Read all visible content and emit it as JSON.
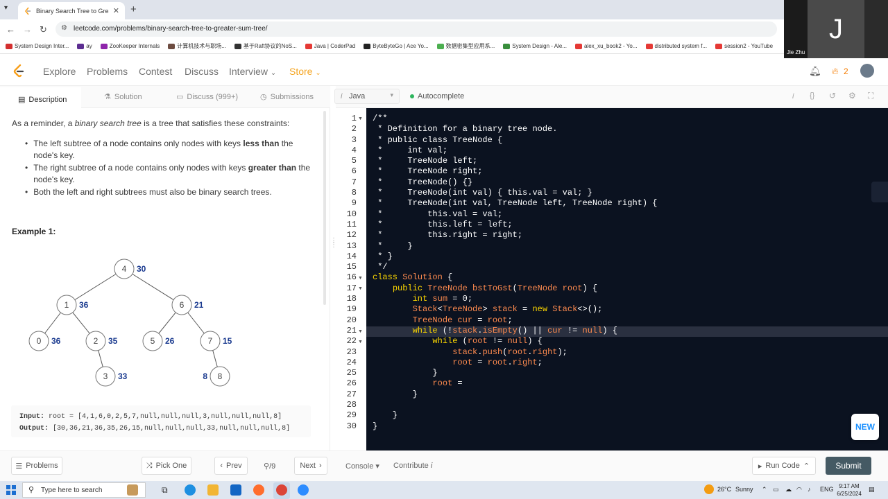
{
  "browser": {
    "tab_title": "Binary Search Tree to Greater Sum Tree",
    "url": "leetcode.com/problems/binary-search-tree-to-greater-sum-tree/",
    "bookmarks": [
      "System Design Inter...",
      "ay",
      "ZooKeeper Internals",
      "计算机技术与职场...",
      "基于Raft协议的NoS...",
      "Java | CoderPad",
      "ByteByteGo | Ace Yo...",
      "数据密集型应用系...",
      "System Design - Ale...",
      "alex_xu_book2 - Yo...",
      "distributed system f...",
      "session2 - YouTube"
    ]
  },
  "webcam": {
    "initial": "J",
    "name": "Jie Zhu"
  },
  "nav": {
    "explore": "Explore",
    "problems": "Problems",
    "contest": "Contest",
    "discuss": "Discuss",
    "interview": "Interview",
    "store": "Store",
    "streak": "2"
  },
  "left_tabs": {
    "description": "Description",
    "solution": "Solution",
    "discuss": "Discuss (999+)",
    "submissions": "Submissions"
  },
  "description": {
    "reminder_pre": "As a reminder, a ",
    "reminder_em": "binary search tree",
    "reminder_post": " is a tree that satisfies these constraints:",
    "b1_pre": "The left subtree of a node contains only nodes with keys ",
    "b1_bold": "less than",
    "b1_post": " the node's key.",
    "b2_pre": "The right subtree of a node contains only nodes with keys ",
    "b2_bold": "greater than",
    "b2_post": " the node's key.",
    "b3": "Both the left and right subtrees must also be binary search trees.",
    "example_title": "Example 1:",
    "input_label": "Input:",
    "input_value": "root = [4,1,6,0,2,5,7,null,null,null,3,null,null,null,8]",
    "output_label": "Output:",
    "output_value": "[30,36,21,36,35,26,15,null,null,null,33,null,null,null,8]"
  },
  "tree": {
    "nodes": [
      {
        "id": "4",
        "sum": "30"
      },
      {
        "id": "1",
        "sum": "36"
      },
      {
        "id": "6",
        "sum": "21"
      },
      {
        "id": "0",
        "sum": "36"
      },
      {
        "id": "2",
        "sum": "35"
      },
      {
        "id": "5",
        "sum": "26"
      },
      {
        "id": "7",
        "sum": "15"
      },
      {
        "id": "3",
        "sum": "33"
      },
      {
        "id": "8",
        "sum": "8"
      }
    ]
  },
  "editor": {
    "language": "Java",
    "autocomplete": "Autocomplete",
    "lines": [
      "/**",
      " * Definition for a binary tree node.",
      " * public class TreeNode {",
      " *     int val;",
      " *     TreeNode left;",
      " *     TreeNode right;",
      " *     TreeNode() {}",
      " *     TreeNode(int val) { this.val = val; }",
      " *     TreeNode(int val, TreeNode left, TreeNode right) {",
      " *         this.val = val;",
      " *         this.left = left;",
      " *         this.right = right;",
      " *     }",
      " * }",
      " */",
      "class Solution {",
      "    public TreeNode bstToGst(TreeNode root) {",
      "        int sum = 0;",
      "        Stack<TreeNode> stack = new Stack<>();",
      "        TreeNode cur = root;",
      "        while (!stack.isEmpty() || cur != null) {",
      "            while (root != null) {",
      "                stack.push(root.right);",
      "                root = root.right;",
      "            }",
      "            root = ",
      "        }",
      "",
      "    }",
      "}"
    ]
  },
  "bottom": {
    "problems": "Problems",
    "pick_one": "Pick One",
    "prev": "Prev",
    "page": "/9",
    "next": "Next",
    "console": "Console",
    "contribute": "Contribute",
    "run_code": "Run Code",
    "submit": "Submit",
    "new_badge": "NEW"
  },
  "taskbar": {
    "search_placeholder": "Type here to search",
    "temp": "26°C",
    "weather": "Sunny",
    "lang": "ENG",
    "time": "9:17 AM",
    "date": "6/25/2024"
  },
  "colors": {
    "editor_bg": "#0b1220",
    "keyword": "#fbd600",
    "type": "#ff8b4f",
    "comment": "#ffffff",
    "orange_accent": "#f5a623",
    "submit_bg": "#455a64"
  }
}
